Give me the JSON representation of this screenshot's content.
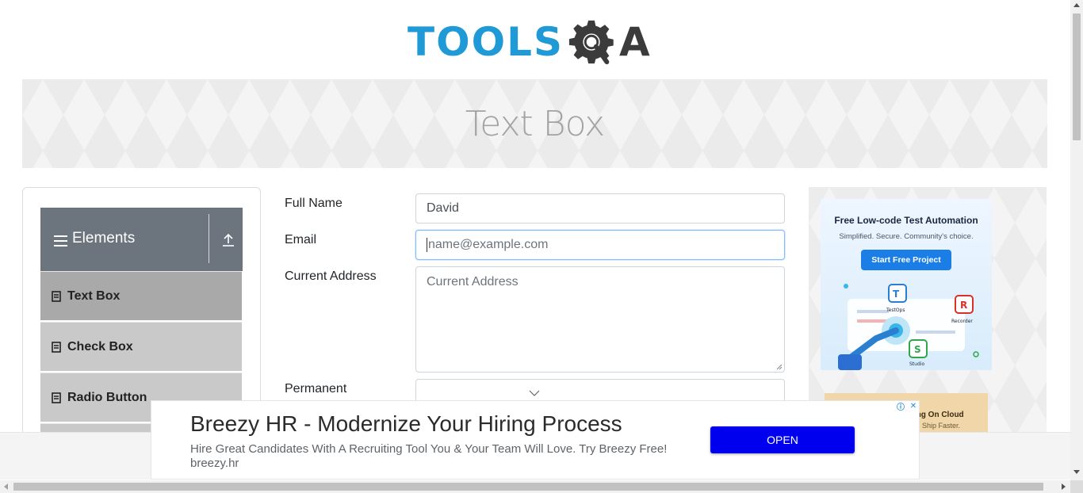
{
  "header": {
    "logo_tools": "TOOLS",
    "logo_qa_letter": "A",
    "brand_colors": {
      "tools": "#1f9ad6",
      "qa": "#3b3b3b"
    }
  },
  "banner": {
    "title": "Text Box"
  },
  "sidebar": {
    "group_title": "Elements",
    "group_icon": "hamburger-icon",
    "collapse_icon": "upload-arrow-icon",
    "items": [
      {
        "label": "Text Box",
        "active": true
      },
      {
        "label": "Check Box",
        "active": false
      },
      {
        "label": "Radio Button",
        "active": false
      }
    ],
    "colors": {
      "header": "#6c757d",
      "item": "#c9c9c9",
      "active_item": "#a9a9a9"
    }
  },
  "form": {
    "full_name": {
      "label": "Full Name",
      "value": "David"
    },
    "email": {
      "label": "Email",
      "placeholder": "name@example.com",
      "value": ""
    },
    "current_address": {
      "label": "Current Address",
      "placeholder": "Current Address",
      "value": ""
    },
    "permanent_address": {
      "label": "Permanent"
    }
  },
  "side_ad": {
    "headline": "Free Low-code Test Automation",
    "subline": "Simplified. Secure. Community's choice.",
    "button": "Start Free Project",
    "apps": [
      "TestOps",
      "Recorder",
      "Studio"
    ],
    "second_headline": "sting On Cloud",
    "second_subline": ". Ship Faster."
  },
  "bottom_ad": {
    "headline": "Breezy HR - Modernize Your Hiring Process",
    "description": "Hire Great Candidates With A Recruiting Tool You & Your Team Will Love. Try Breezy Free!",
    "domain": "breezy.hr",
    "button": "OPEN",
    "button_color": "#0000ee"
  }
}
